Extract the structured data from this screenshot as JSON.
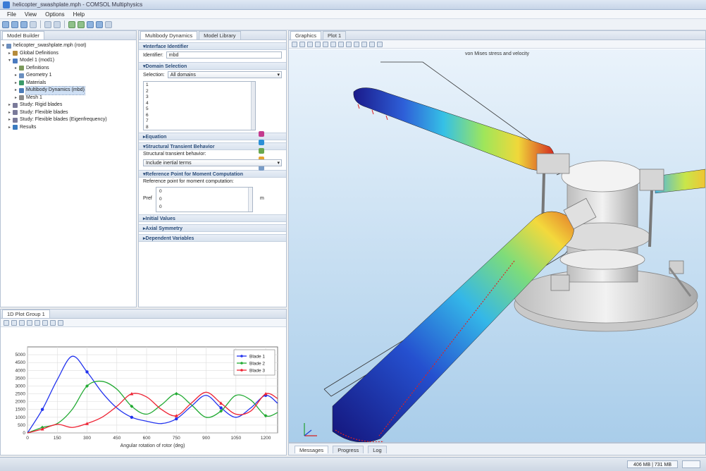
{
  "window": {
    "title": "helicopter_swashplate.mph - COMSOL Multiphysics"
  },
  "menu": [
    "File",
    "View",
    "Options",
    "Help"
  ],
  "model_builder": {
    "tab_label": "Model Builder",
    "tree": [
      {
        "label": "helicopter_swashplate.mph (root)",
        "level": 0,
        "exp": "▾",
        "color": "#6d8fbf"
      },
      {
        "label": "Global Definitions",
        "level": 1,
        "exp": "▸",
        "color": "#b58b3b"
      },
      {
        "label": "Model 1 (mod1)",
        "level": 1,
        "exp": "▾",
        "color": "#4b7bbf"
      },
      {
        "label": "Definitions",
        "level": 2,
        "exp": "▸",
        "color": "#7c9a5a"
      },
      {
        "label": "Geometry 1",
        "level": 2,
        "exp": "▸",
        "color": "#6a8fbf"
      },
      {
        "label": "Materials",
        "level": 2,
        "exp": "▸",
        "color": "#3b9a6a"
      },
      {
        "label": "Multibody Dynamics (mbd)",
        "level": 2,
        "exp": "▸",
        "color": "#4a7ab8",
        "selected": true
      },
      {
        "label": "Mesh 1",
        "level": 2,
        "exp": "▸",
        "color": "#8a8a8a"
      },
      {
        "label": "Study: Rigid blades",
        "level": 1,
        "exp": "▸",
        "color": "#7a7a9a"
      },
      {
        "label": "Study: Flexible blades",
        "level": 1,
        "exp": "▸",
        "color": "#7a7a9a"
      },
      {
        "label": "Study: Flexible blades (Eigenfrequency)",
        "level": 1,
        "exp": "▸",
        "color": "#7a7a9a"
      },
      {
        "label": "Results",
        "level": 1,
        "exp": "▸",
        "color": "#3b7bbf"
      }
    ]
  },
  "settings": {
    "tabs": [
      "Multibody Dynamics",
      "Model Library"
    ],
    "sections": {
      "interface_identifier": "Interface Identifier",
      "domain_selection": "Domain Selection",
      "equation": "Equation",
      "structural_transient": "Structural Transient Behavior",
      "reference_point": "Reference Point for Moment Computation",
      "initial_values": "Initial Values",
      "axial_symmetry": "Axial Symmetry",
      "dependent_variables": "Dependent Variables"
    },
    "identifier_label": "Identifier:",
    "identifier_value": "mbd",
    "selection_label": "Selection:",
    "selection_value": "All domains",
    "domain_list": [
      "1",
      "2",
      "3",
      "4",
      "5",
      "6",
      "7",
      "8",
      "9"
    ],
    "transient_label": "Structural transient behavior:",
    "transient_value": "Include inertial terms",
    "refpoint_label": "Reference point for moment computation:",
    "refpoint_symbol": "Pref",
    "refpoint_values": [
      "0",
      "0",
      "0"
    ],
    "refpoint_unit": "m"
  },
  "graphics": {
    "tabs": [
      "Graphics",
      "Plot 1"
    ],
    "title": "von Mises stress and velocity"
  },
  "plot": {
    "tab_label": "1D Plot Group 1"
  },
  "messages": {
    "tabs": [
      "Messages",
      "Progress",
      "Log"
    ]
  },
  "status": {
    "memory": "406 MB | 731 MB"
  },
  "chart_data": {
    "type": "line",
    "title": "",
    "xlabel": "Angular rotation of rotor (deg)",
    "ylabel": "",
    "xlim": [
      0,
      1260
    ],
    "ylim": [
      0,
      5500
    ],
    "xticks": [
      0,
      150,
      300,
      450,
      600,
      750,
      900,
      1050,
      1200
    ],
    "yticks": [
      0,
      500,
      1000,
      1500,
      2000,
      2500,
      3000,
      3500,
      4000,
      4500,
      5000
    ],
    "grid": true,
    "legend": "top-right",
    "series": [
      {
        "name": "Blade 1",
        "color": "#2233ee",
        "marker": "dot",
        "x": [
          0,
          75,
          150,
          225,
          300,
          375,
          450,
          525,
          600,
          675,
          750,
          825,
          900,
          975,
          1050,
          1125,
          1200,
          1260
        ],
        "y": [
          0,
          1500,
          3400,
          4900,
          3900,
          2600,
          1600,
          1000,
          750,
          600,
          900,
          1700,
          2400,
          1600,
          1000,
          1600,
          2400,
          1900
        ]
      },
      {
        "name": "Blade 2",
        "color": "#22aa33",
        "marker": "diamond",
        "x": [
          0,
          75,
          150,
          225,
          300,
          375,
          450,
          525,
          600,
          675,
          750,
          825,
          900,
          975,
          1050,
          1125,
          1200,
          1260
        ],
        "y": [
          0,
          350,
          600,
          1500,
          3000,
          3300,
          2800,
          1700,
          1200,
          1800,
          2500,
          1800,
          1000,
          1400,
          2400,
          2100,
          1100,
          1300
        ]
      },
      {
        "name": "Blade 3",
        "color": "#ee2233",
        "marker": "triangle",
        "x": [
          0,
          75,
          150,
          225,
          300,
          375,
          450,
          525,
          600,
          675,
          750,
          825,
          900,
          975,
          1050,
          1125,
          1200,
          1260
        ],
        "y": [
          0,
          250,
          550,
          350,
          600,
          1000,
          1700,
          2500,
          2300,
          1500,
          1100,
          1900,
          2600,
          1900,
          1200,
          1400,
          2500,
          2200
        ]
      }
    ]
  }
}
